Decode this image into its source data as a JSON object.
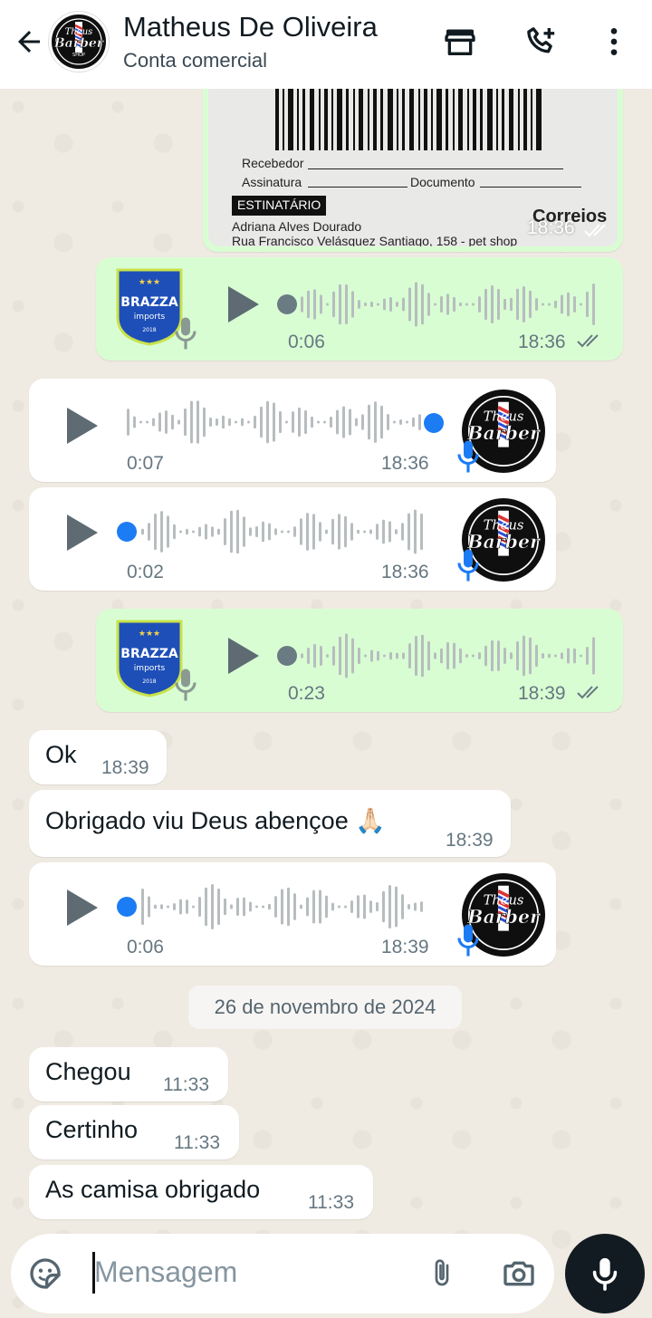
{
  "header": {
    "contact_name": "Matheus De Oliveira",
    "subtitle": "Conta comercial",
    "icons": [
      "back-arrow-icon",
      "store-icon",
      "add-call-icon",
      "more-vert-icon"
    ]
  },
  "image_message": {
    "label_recebedor": "Recebedor",
    "label_assinatura": "Assinatura",
    "label_documento": "Documento",
    "label_destinatario": "ESTINATÁRIO",
    "recipient_name": "Adriana Alves Dourado",
    "recipient_address": "Rua Francisco Velásquez Santiago, 158 - pet shop",
    "carrier": "Correios",
    "time": "18:36"
  },
  "messages": [
    {
      "type": "audio",
      "direction": "out",
      "duration": "0:06",
      "time": "18:36",
      "progress": 0
    },
    {
      "type": "audio",
      "direction": "in",
      "duration": "0:07",
      "time": "18:36",
      "progress": 1
    },
    {
      "type": "audio",
      "direction": "in",
      "duration": "0:02",
      "time": "18:36",
      "progress": 0
    },
    {
      "type": "audio",
      "direction": "out",
      "duration": "0:23",
      "time": "18:39",
      "progress": 0
    },
    {
      "type": "text",
      "direction": "in",
      "text": "Ok",
      "time": "18:39"
    },
    {
      "type": "text",
      "direction": "in",
      "text": "Obrigado viu Deus abençoe 🙏🏻",
      "time": "18:39"
    },
    {
      "type": "audio",
      "direction": "in",
      "duration": "0:06",
      "time": "18:39",
      "progress": 0
    },
    {
      "type": "text",
      "direction": "in",
      "text": "Chegou",
      "time": "11:33"
    },
    {
      "type": "text",
      "direction": "in",
      "text": "Certinho",
      "time": "11:33"
    },
    {
      "type": "text",
      "direction": "in",
      "text": "As camisa obrigado",
      "time": "11:33"
    }
  ],
  "date_separator": "26 de novembro de 2024",
  "avatar_barber": {
    "line1": "Theus",
    "line2": "Barber",
    "line3": "SHOP"
  },
  "avatar_brazza": {
    "line1": "BRAZZA",
    "line2": "imports",
    "line3": "2018"
  },
  "composer": {
    "placeholder": "Mensagem"
  },
  "colors": {
    "outgoing_bubble": "#d9fdd3",
    "incoming_bubble": "#ffffff",
    "accent_blue": "#1c7cf4",
    "tick_grey": "#667781",
    "wall": "#efeae2"
  }
}
